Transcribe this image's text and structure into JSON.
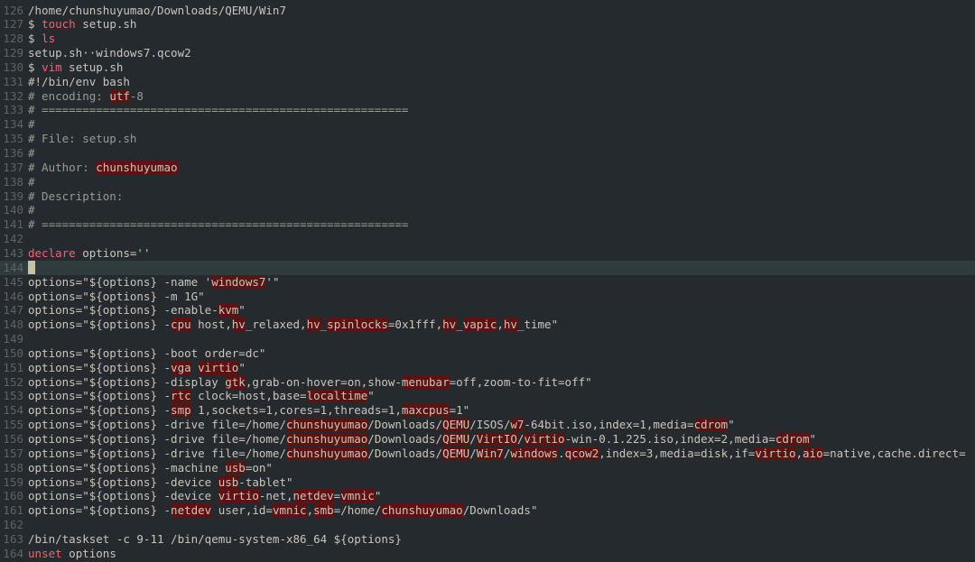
{
  "editor": {
    "app": "vim",
    "file": "setup.sh",
    "cursor_line": 144
  },
  "colors": {
    "background": "#252a2e",
    "keyword": "#f06472",
    "comment": "#9a9a92",
    "highlight": "#5e1313",
    "gutter": "#5d6367",
    "text": "#c9c5bb",
    "current_line": "#2f3b3d"
  },
  "lines": [
    {
      "n": "126",
      "segs": [
        [
          "/home/chunshuyumao/Downloads/QEMU/Win7",
          ""
        ]
      ]
    },
    {
      "n": "127",
      "segs": [
        [
          "$ ",
          ""
        ],
        [
          "touch",
          "kw"
        ],
        [
          " setup.sh",
          ""
        ]
      ]
    },
    {
      "n": "128",
      "segs": [
        [
          "$ ",
          ""
        ],
        [
          "ls",
          "kw"
        ]
      ]
    },
    {
      "n": "129",
      "segs": [
        [
          "setup.sh··windows7.qcow2",
          ""
        ]
      ]
    },
    {
      "n": "130",
      "segs": [
        [
          "$ ",
          ""
        ],
        [
          "vim",
          "kw"
        ],
        [
          " setup.sh",
          ""
        ]
      ]
    },
    {
      "n": "131",
      "segs": [
        [
          "#!/bin/env bash",
          ""
        ]
      ]
    },
    {
      "n": "132",
      "segs": [
        [
          "# encoding: ",
          "cm"
        ],
        [
          "utf",
          "hl"
        ],
        [
          "-8",
          "cm"
        ]
      ]
    },
    {
      "n": "133",
      "segs": [
        [
          "# ======================================================",
          "cm"
        ]
      ]
    },
    {
      "n": "134",
      "segs": [
        [
          "#",
          "cm"
        ]
      ]
    },
    {
      "n": "135",
      "segs": [
        [
          "# File: setup.sh",
          "cm"
        ]
      ]
    },
    {
      "n": "136",
      "segs": [
        [
          "#",
          "cm"
        ]
      ]
    },
    {
      "n": "137",
      "segs": [
        [
          "# Author: ",
          "cm"
        ],
        [
          "chunshuyumao",
          "hl"
        ]
      ]
    },
    {
      "n": "138",
      "segs": [
        [
          "#",
          "cm"
        ]
      ]
    },
    {
      "n": "139",
      "segs": [
        [
          "# Description:",
          "cm"
        ]
      ]
    },
    {
      "n": "140",
      "segs": [
        [
          "#",
          "cm"
        ]
      ]
    },
    {
      "n": "141",
      "segs": [
        [
          "# ======================================================",
          "cm"
        ]
      ]
    },
    {
      "n": "142",
      "segs": []
    },
    {
      "n": "143",
      "segs": [
        [
          "declare",
          "kw"
        ],
        [
          " options=''",
          ""
        ]
      ]
    },
    {
      "n": "144",
      "cursor": true,
      "segs": []
    },
    {
      "n": "145",
      "segs": [
        [
          "options=\"${options} -name '",
          ""
        ],
        [
          "windows7",
          "hl"
        ],
        [
          "'\"",
          ""
        ]
      ]
    },
    {
      "n": "146",
      "segs": [
        [
          "options=\"${options} -m 1G\"",
          ""
        ]
      ]
    },
    {
      "n": "147",
      "segs": [
        [
          "options=\"${options} -enable-",
          ""
        ],
        [
          "kvm",
          "hl"
        ],
        [
          "\"",
          ""
        ]
      ]
    },
    {
      "n": "148",
      "segs": [
        [
          "options=\"${options} -",
          ""
        ],
        [
          "cpu",
          "hl"
        ],
        [
          " host,",
          ""
        ],
        [
          "hv",
          "hl"
        ],
        [
          "_relaxed,",
          ""
        ],
        [
          "hv",
          "hl"
        ],
        [
          "_",
          ""
        ],
        [
          "spinlocks",
          "hl"
        ],
        [
          "=0x1fff,",
          ""
        ],
        [
          "hv",
          "hl"
        ],
        [
          "_",
          ""
        ],
        [
          "vapic",
          "hl"
        ],
        [
          ",",
          ""
        ],
        [
          "hv",
          "hl"
        ],
        [
          "_time\"",
          ""
        ]
      ]
    },
    {
      "n": "149",
      "segs": []
    },
    {
      "n": "150",
      "segs": [
        [
          "options=\"${options} -boot order=dc\"",
          ""
        ]
      ]
    },
    {
      "n": "151",
      "segs": [
        [
          "options=\"${options} -",
          ""
        ],
        [
          "vga",
          "hl"
        ],
        [
          " ",
          ""
        ],
        [
          "virtio",
          "hl"
        ],
        [
          "\"",
          ""
        ]
      ]
    },
    {
      "n": "152",
      "segs": [
        [
          "options=\"${options} -display ",
          ""
        ],
        [
          "gtk",
          "hl"
        ],
        [
          ",grab-on-hover=on,show-",
          ""
        ],
        [
          "menubar",
          "hl"
        ],
        [
          "=off,zoom-to-fit=off\"",
          ""
        ]
      ]
    },
    {
      "n": "153",
      "segs": [
        [
          "options=\"${options} -",
          ""
        ],
        [
          "rtc",
          "hl"
        ],
        [
          " clock=host,base=",
          ""
        ],
        [
          "localtime",
          "hl"
        ],
        [
          "\"",
          ""
        ]
      ]
    },
    {
      "n": "154",
      "segs": [
        [
          "options=\"${options} -",
          ""
        ],
        [
          "smp",
          "hl"
        ],
        [
          " 1,sockets=1,cores=1,threads=1,",
          ""
        ],
        [
          "maxcpus",
          "hl"
        ],
        [
          "=1\"",
          ""
        ]
      ]
    },
    {
      "n": "155",
      "segs": [
        [
          "options=\"${options} -drive file=/home/",
          ""
        ],
        [
          "chunshuyumao",
          "hl"
        ],
        [
          "/Downloads/",
          ""
        ],
        [
          "QEMU",
          "hl"
        ],
        [
          "/ISOS/",
          ""
        ],
        [
          "w7",
          "hl"
        ],
        [
          "-64bit.iso,index=1,media=",
          ""
        ],
        [
          "cdrom",
          "hl"
        ],
        [
          "\"",
          ""
        ]
      ]
    },
    {
      "n": "156",
      "segs": [
        [
          "options=\"${options} -drive file=/home/",
          ""
        ],
        [
          "chunshuyumao",
          "hl"
        ],
        [
          "/Downloads/",
          ""
        ],
        [
          "QEMU",
          "hl"
        ],
        [
          "/",
          ""
        ],
        [
          "VirtIO",
          "hl"
        ],
        [
          "/",
          ""
        ],
        [
          "virtio",
          "hl"
        ],
        [
          "-win-0.1.225.iso,index=2,media=",
          ""
        ],
        [
          "cdrom",
          "hl"
        ],
        [
          "\"",
          ""
        ]
      ]
    },
    {
      "n": "157",
      "segs": [
        [
          "options=\"${options} -drive file=/home/",
          ""
        ],
        [
          "chunshuyumao",
          "hl"
        ],
        [
          "/Downloads/",
          ""
        ],
        [
          "QEMU",
          "hl"
        ],
        [
          "/",
          ""
        ],
        [
          "Win7",
          "hl"
        ],
        [
          "/",
          ""
        ],
        [
          "windows",
          "hl"
        ],
        [
          ".",
          ""
        ],
        [
          "qcow2",
          "hl"
        ],
        [
          ",index=3,media=disk,if=",
          ""
        ],
        [
          "virtio",
          "hl"
        ],
        [
          ",",
          ""
        ],
        [
          "aio",
          "hl"
        ],
        [
          "=native,cache.direct=",
          ""
        ]
      ]
    },
    {
      "n": "158",
      "segs": [
        [
          "options=\"${options} -machine ",
          ""
        ],
        [
          "usb",
          "hl"
        ],
        [
          "=on\"",
          ""
        ]
      ]
    },
    {
      "n": "159",
      "segs": [
        [
          "options=\"${options} -device ",
          ""
        ],
        [
          "usb",
          "hl"
        ],
        [
          "-tablet\"",
          ""
        ]
      ]
    },
    {
      "n": "160",
      "segs": [
        [
          "options=\"${options} -device ",
          ""
        ],
        [
          "virtio",
          "hl"
        ],
        [
          "-net,",
          ""
        ],
        [
          "netdev",
          "hl"
        ],
        [
          "=",
          ""
        ],
        [
          "vmnic",
          "hl"
        ],
        [
          "\"",
          ""
        ]
      ]
    },
    {
      "n": "161",
      "segs": [
        [
          "options=\"${options} -",
          ""
        ],
        [
          "netdev",
          "hl"
        ],
        [
          " user,id=",
          ""
        ],
        [
          "vmnic",
          "hl"
        ],
        [
          ",",
          ""
        ],
        [
          "smb",
          "hl"
        ],
        [
          "=/home/",
          ""
        ],
        [
          "chunshuyumao",
          "hl"
        ],
        [
          "/Downloads\"",
          ""
        ]
      ]
    },
    {
      "n": "162",
      "segs": []
    },
    {
      "n": "163",
      "segs": [
        [
          "/bin/taskset -c 9-11 /bin/qemu-system-x86_64 ${options}",
          ""
        ]
      ]
    },
    {
      "n": "164",
      "segs": [
        [
          "unset",
          "kw"
        ],
        [
          " options",
          ""
        ]
      ]
    }
  ]
}
